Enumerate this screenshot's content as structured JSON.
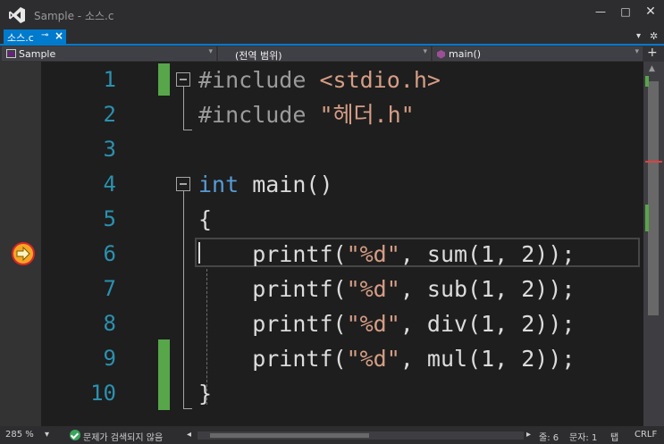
{
  "window": {
    "title": "Sample - 소스.c"
  },
  "tab": {
    "label": "소스.c",
    "pin_icon": "⊸",
    "close_icon": "×"
  },
  "nav": {
    "project": "Sample",
    "scope": "(전역 범위)",
    "member": "main()"
  },
  "editor": {
    "line_numbers": [
      "1",
      "2",
      "3",
      "4",
      "5",
      "6",
      "7",
      "8",
      "9",
      "10"
    ],
    "lines": {
      "l1a": "#include ",
      "l1b": "<stdio.h>",
      "l2a": "#include ",
      "l2b": "\"헤더.h\"",
      "l4a": "int",
      "l4b": " main()",
      "l5": "{",
      "l6a": "    printf(",
      "l6b": "\"%d\"",
      "l6c": ", sum(1, 2));",
      "l7a": "    printf(",
      "l7b": "\"%d\"",
      "l7c": ", sub(1, 2));",
      "l8a": "    printf(",
      "l8b": "\"%d\"",
      "l8c": ", div(1, 2));",
      "l9a": "    printf(",
      "l9b": "\"%d\"",
      "l9c": ", mul(1, 2));",
      "l10": "}"
    }
  },
  "statusbar": {
    "zoom": "285 %",
    "issues": "문제가 검색되지 않음",
    "line": "줄: 6",
    "col": "문자: 1",
    "indent": "탭",
    "eol": "CRLF"
  },
  "colors": {
    "accent": "#007acc",
    "change_bar": "#57a64a",
    "breakpoint": "#f5a623"
  }
}
